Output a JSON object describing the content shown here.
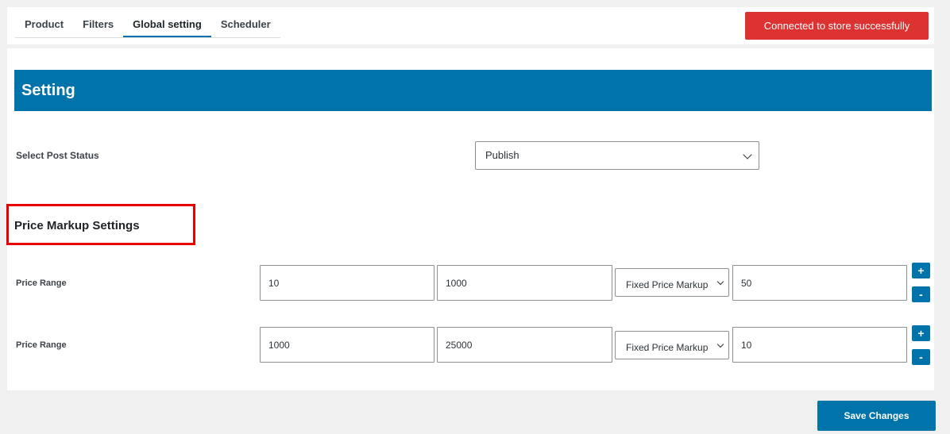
{
  "tabs": [
    {
      "label": "Product"
    },
    {
      "label": "Filters"
    },
    {
      "label": "Global setting"
    },
    {
      "label": "Scheduler"
    }
  ],
  "status": {
    "label": "Connected to store successfully",
    "color": "#dc3232"
  },
  "banner": {
    "title": "Setting",
    "color": "#0073aa"
  },
  "post_status": {
    "label": "Select Post Status",
    "value": "Publish"
  },
  "markup": {
    "title": "Price Markup Settings",
    "rows": [
      {
        "label": "Price Range",
        "from": "10",
        "to": "1000",
        "type": "Fixed Price Markup",
        "amount": "50",
        "add": "+",
        "remove": "-"
      },
      {
        "label": "Price Range",
        "from": "1000",
        "to": "25000",
        "type": "Fixed Price Markup",
        "amount": "10",
        "add": "+",
        "remove": "-"
      }
    ]
  },
  "save": {
    "label": "Save Changes"
  }
}
